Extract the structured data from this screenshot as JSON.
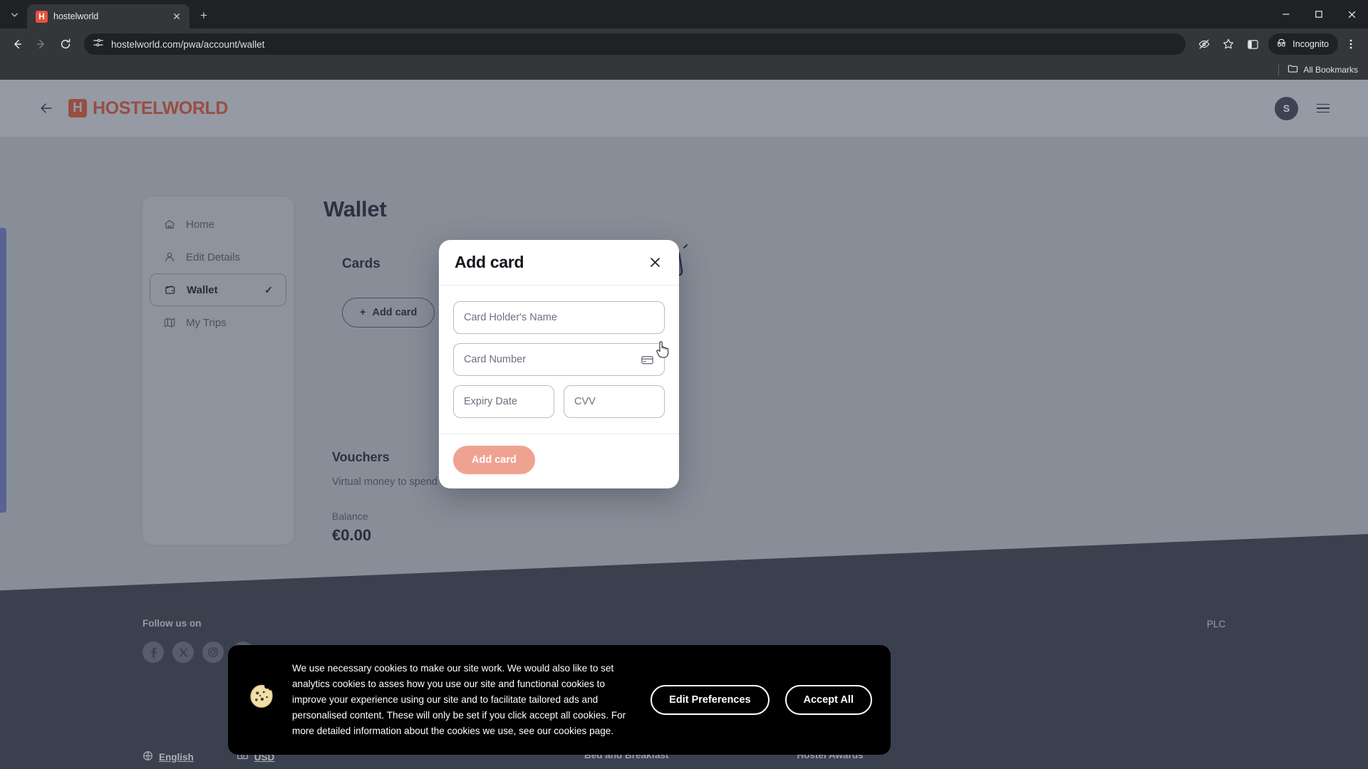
{
  "browser": {
    "tab": {
      "title": "hostelworld",
      "favicon_letter": "H",
      "favicon_name": "hostelworld-favicon"
    },
    "new_tab_label": "+",
    "close_tab_label": "✕",
    "tab_list_chevron": "⌄",
    "window": {
      "minimize": "–",
      "maximize": "□",
      "close": "✕"
    },
    "nav": {
      "back": "←",
      "forward": "→",
      "reload": "↻"
    },
    "omnibox": {
      "url": "hostelworld.com/pwa/account/wallet",
      "site_info_icon": "tune-icon"
    },
    "actions": {
      "hide_password_icon": "eye-slash-icon",
      "bookmark_icon": "star-icon",
      "side_panel_icon": "side-panel-icon",
      "incognito_label": "Incognito",
      "menu_icon": "three-dot-menu-icon"
    },
    "bookmarks_bar": {
      "all_bookmarks_label": "All Bookmarks"
    }
  },
  "site": {
    "header": {
      "back_label": "←",
      "logo_mark": "H",
      "logo_text": "HOSTELWORLD",
      "avatar_initial": "S",
      "brand_color": "#c4604f"
    },
    "sidebar": {
      "items": [
        {
          "label": "Home",
          "icon": "home-icon",
          "active": false
        },
        {
          "label": "Edit Details",
          "icon": "person-icon",
          "active": false
        },
        {
          "label": "Wallet",
          "icon": "wallet-icon",
          "active": true,
          "check": "✓"
        },
        {
          "label": "My Trips",
          "icon": "map-icon",
          "active": false
        }
      ]
    },
    "main": {
      "page_title": "Wallet",
      "cards_section": {
        "heading": "Cards",
        "add_card_label": "Add card",
        "add_card_plus": "+",
        "illustration": "credit-cards-illustration"
      },
      "vouchers_section": {
        "heading": "Vouchers",
        "description": "Virtual money to spend only on H",
        "balance_label": "Balance",
        "balance_value": "€0.00"
      }
    },
    "footer": {
      "follow_label": "Follow us on",
      "socials": [
        {
          "name": "facebook-icon"
        },
        {
          "name": "x-twitter-icon"
        },
        {
          "name": "instagram-icon"
        },
        {
          "name": "youtube-icon"
        }
      ],
      "language": {
        "label": "English",
        "icon": "globe-icon"
      },
      "currency": {
        "label": "USD",
        "icon": "money-icon"
      },
      "company_suffix": "PLC",
      "columns": [
        "Bed and Breakfast",
        "Hostel Awards"
      ]
    }
  },
  "modal": {
    "title": "Add card",
    "close_label": "✕",
    "fields": [
      {
        "placeholder": "Card Holder's Name",
        "value": "",
        "icon": null
      },
      {
        "placeholder": "Card Number",
        "value": "",
        "icon": "credit-card-icon"
      },
      {
        "placeholder": "Expiry Date",
        "value": "",
        "icon": null
      },
      {
        "placeholder": "CVV",
        "value": "",
        "icon": null
      }
    ],
    "submit_label": "Add card",
    "submit_color": "#f0a291",
    "submit_disabled": true
  },
  "cookie_banner": {
    "icon": "cookie-icon",
    "text": "We use necessary cookies to make our site work. We would also like to set analytics cookies to asses how you use our site and functional cookies to improve your experience using our site and to facilitate tailored ads and personalised content. These will only be set if you click accept all cookies. For more detailed information about the cookies we use, see our cookies page.",
    "edit_label": "Edit Preferences",
    "accept_label": "Accept All"
  }
}
